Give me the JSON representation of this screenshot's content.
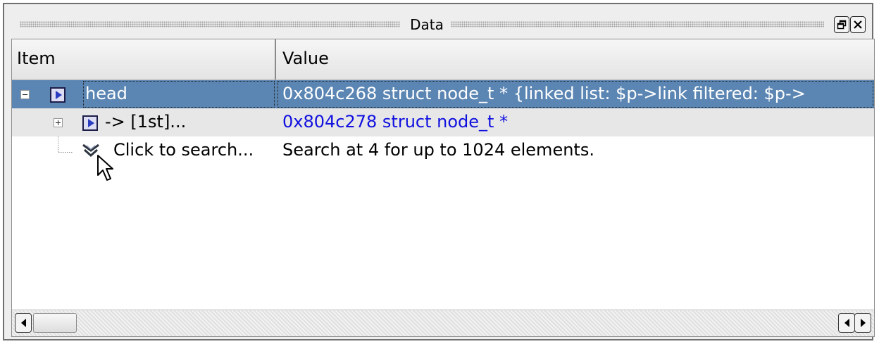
{
  "window": {
    "title": "Data"
  },
  "columns": {
    "item": "Item",
    "value": "Value"
  },
  "rows": [
    {
      "name": "head",
      "value": "0x804c268 struct node_t * {linked list: $p->link filtered: $p->",
      "icon": "expand-arrow-icon",
      "expander": "collapse"
    },
    {
      "name": "-> [1st]...",
      "value": "0x804c278 struct node_t *",
      "icon": "expand-arrow-icon",
      "expander": "expand"
    },
    {
      "name": "Click to search...",
      "value": "Search at 4 for up to 1024 elements.",
      "icon": "double-chevron-down-icon"
    }
  ],
  "colors": {
    "selection": "#5b86b3",
    "link": "#1010e0"
  }
}
